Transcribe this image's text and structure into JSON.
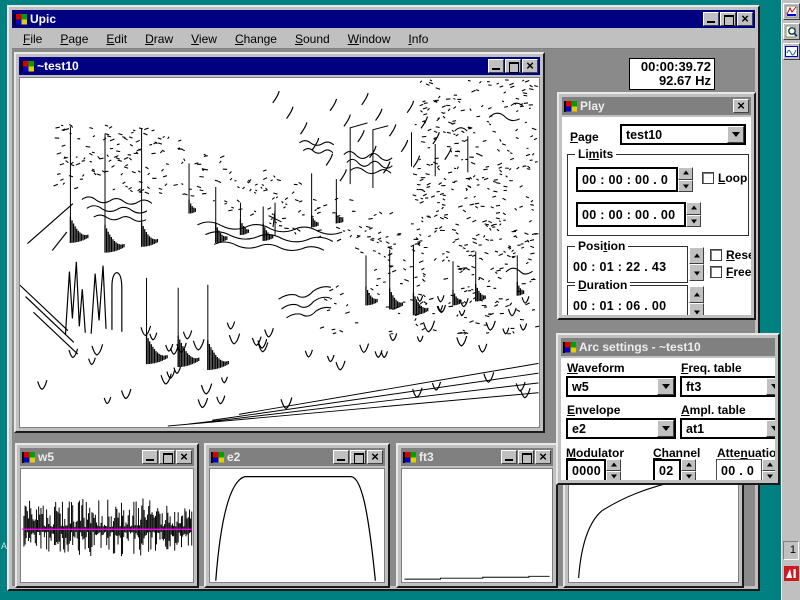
{
  "app": {
    "title": "Upic",
    "menu": [
      {
        "text": "File",
        "key": 0
      },
      {
        "text": "Page",
        "key": 0
      },
      {
        "text": "Edit",
        "key": 0
      },
      {
        "text": "Draw",
        "key": 0
      },
      {
        "text": "View",
        "key": 0
      },
      {
        "text": "Change",
        "key": 0
      },
      {
        "text": "Sound",
        "key": 0
      },
      {
        "text": "Window",
        "key": 0
      },
      {
        "text": "Info",
        "key": 0
      }
    ]
  },
  "time_display": {
    "time": "00:00:39.72",
    "freq": "92.67 Hz"
  },
  "score_window": {
    "title": "~test10"
  },
  "play_dialog": {
    "title": "Play",
    "page_label": {
      "text": "Page",
      "key": 0
    },
    "page_value": "test10",
    "limits_label": {
      "text": "Limits",
      "key": 2
    },
    "limit_start": "00 : 00 : 00 . 0",
    "limit_end": "00 : 00 : 00 . 00",
    "loop_label": {
      "text": "Loop",
      "key": 0
    },
    "position_label": {
      "text": "Position",
      "key": 4
    },
    "position_value": "00 : 01 : 22 . 43",
    "reset_label": {
      "text": "Reset",
      "key": 0
    },
    "freeze_label": {
      "text": "Freeze",
      "key": 0
    },
    "duration_label": {
      "text": "Duration",
      "key": 0
    },
    "duration_value": "00 : 01 : 06 . 00"
  },
  "arc_dialog": {
    "title": "Arc settings - ~test10",
    "waveform_label": {
      "text": "Waveform",
      "key": 0
    },
    "waveform_value": "w5",
    "freq_table_label": {
      "text": "Freq. table",
      "key": 0
    },
    "freq_table_value": "ft3",
    "envelope_label": {
      "text": "Envelope",
      "key": 0
    },
    "envelope_value": "e2",
    "ampl_table_label": {
      "text": "Ampl. table",
      "key": 0
    },
    "ampl_table_value": "at1",
    "modulator_label": {
      "text": "Modulator",
      "key": 0
    },
    "modulator_value": "0000",
    "channel_label": {
      "text": "Channel",
      "key": 0
    },
    "channel_value": "02",
    "attenuation_label": {
      "text": "Attenuation",
      "key": 4
    },
    "attenuation_value": "00 . 0"
  },
  "windows": {
    "w5": {
      "title": "w5"
    },
    "e2": {
      "title": "e2"
    },
    "ft3": {
      "title": "ft3"
    }
  },
  "desktop": {
    "side_page_number": "1",
    "left_letter": "A"
  },
  "colors": {
    "desktop": "#008080",
    "titlebar_active": "#000080",
    "titlebar_inactive": "#808080",
    "chrome": "#c0c0c0",
    "workspace": "#8a8a8a",
    "waveform_axis": "#ff00ff"
  }
}
